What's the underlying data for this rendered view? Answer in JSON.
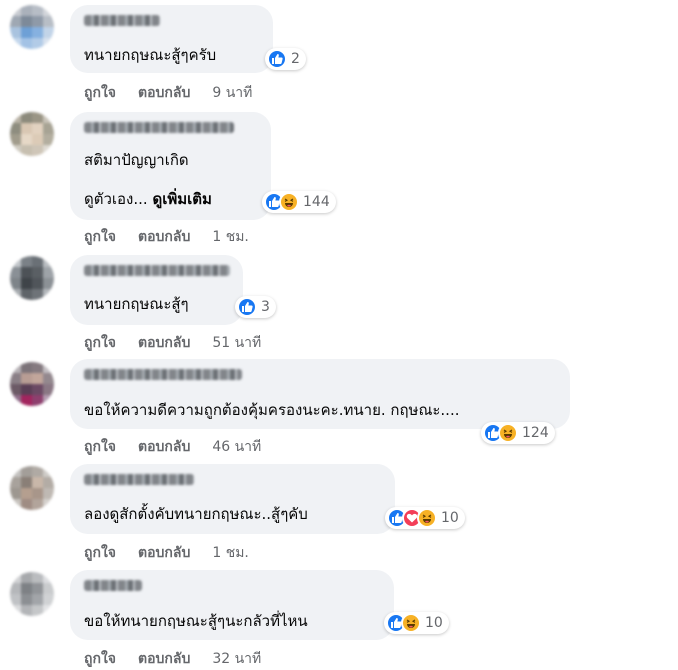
{
  "colors": {
    "like": "#1877f2",
    "haha": "#f7b125",
    "love": "#f33e58",
    "bubble": "#f0f2f5",
    "meta": "#65676b"
  },
  "labels": {
    "like_action": "ถูกใจ",
    "reply_action": "ตอบกลับ"
  },
  "comments": [
    {
      "text": "ทนายกฤษณะสู้ๆครับ",
      "reactions": [
        "like-icon"
      ],
      "reaction_count": "2",
      "time": "9 นาที"
    },
    {
      "text": "สติมาปัญญาเกิด",
      "text2": "ดูตัวเอง...",
      "see_more": "ดูเพิ่มเติม",
      "reactions": [
        "like-icon",
        "haha-icon"
      ],
      "reaction_count": "144",
      "time": "1 ชม."
    },
    {
      "text": "ทนายกฤษณะสู้ๆ",
      "reactions": [
        "like-icon"
      ],
      "reaction_count": "3",
      "time": "51 นาที"
    },
    {
      "text": "ขอให้ความดีความถูกต้องคุ้มครองนะคะ.ทนาย. กฤษณะ....",
      "reactions": [
        "like-icon",
        "haha-icon"
      ],
      "reaction_count": "124",
      "time": "46 นาที"
    },
    {
      "text": "ลองดูสักตั้งคับทนายกฤษณะ..สู้ๆคับ",
      "reactions": [
        "like-icon",
        "love-icon",
        "haha-icon"
      ],
      "reaction_count": "10",
      "time": "1 ชม."
    },
    {
      "text": "ขอให้ทนายกฤษณะสู้ๆนะกลัวที่ไหน",
      "reactions": [
        "like-icon",
        "haha-icon"
      ],
      "reaction_count": "10",
      "time": "32 นาที"
    }
  ]
}
